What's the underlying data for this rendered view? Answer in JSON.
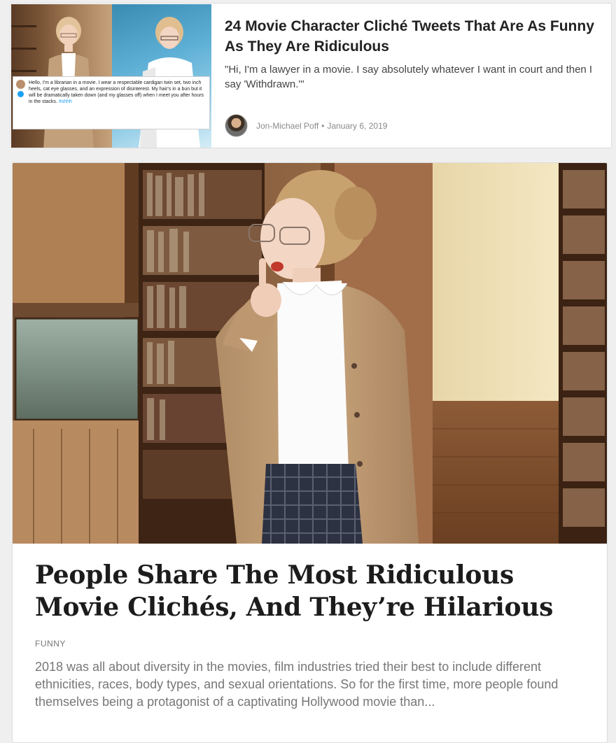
{
  "small_card": {
    "title": "24 Movie Character Cliché Tweets That Are As Funny As They Are Ridiculous",
    "excerpt": "\"Hi, I'm a lawyer in a movie. I say absolutely whatever I want in court and then I say 'Withdrawn.'\"",
    "author": "Jon-Michael Poff",
    "separator": "•",
    "date": "January 6, 2019",
    "thumbnail_tweet": {
      "text": "Hello, I'm a librarian in a movie. I wear a respectable cardigan twin set, two inch heels, cat eye glasses, and an expression of disinterest. My hair's in a bun but it will be dramatically taken down (and my glasses off) when I meet you after hours in the stacks.",
      "hashtag": "#shhh"
    }
  },
  "large_card": {
    "title": "People Share The Most Ridiculous Movie Clichés, And They’re Hilarious",
    "category": "FUNNY",
    "excerpt": "2018 was all about diversity in the movies, film industries tried their best to include different ethnicities, races, body types, and sexual orientations. So for the first time, more people found themselves being a protagonist of a captivating Hollywood movie than..."
  },
  "colors": {
    "page_background": "#efefef",
    "card_background": "#ffffff",
    "title_text": "#222222",
    "muted_text": "#777777",
    "hashtag": "#1da1f2"
  }
}
